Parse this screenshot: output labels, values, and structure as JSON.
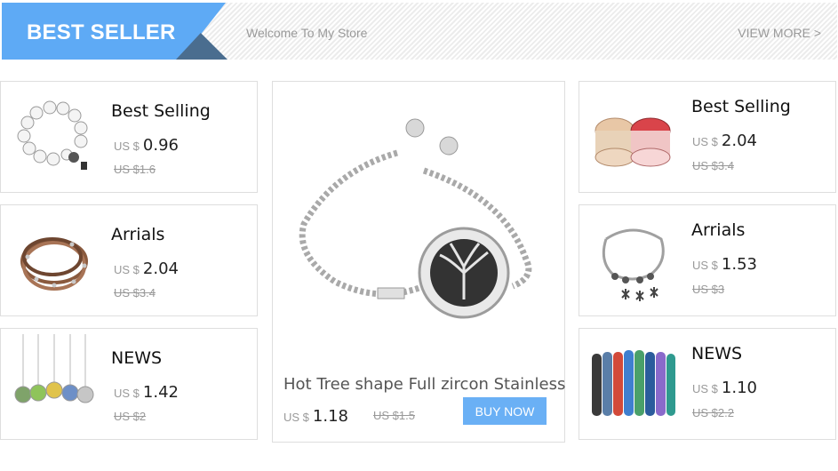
{
  "header": {
    "title": "BEST SELLER",
    "subtitle": "Welcome To My Store",
    "view_more": "VIEW MORE >"
  },
  "left_column": [
    {
      "name": "Best Selling",
      "currency": "US $",
      "price": "0.96",
      "old_price": "US $1.6",
      "icon": "pearl-bracelet-icon"
    },
    {
      "name": "Arrials",
      "currency": "US $",
      "price": "2.04",
      "old_price": "US $3.4",
      "icon": "leather-wrap-bracelet-icon"
    },
    {
      "name": "NEWS",
      "currency": "US $",
      "price": "1.42",
      "old_price": "US $2",
      "icon": "pendant-necklaces-icon"
    }
  ],
  "featured": {
    "title": "Hot Tree shape Full zircon Stainless",
    "currency": "US $",
    "price": "1.18",
    "old_price": "US $1.5",
    "button": "BUY NOW",
    "icon": "tree-of-life-bracelet-icon"
  },
  "right_column": [
    {
      "name": "Best Selling",
      "currency": "US $",
      "price": "2.04",
      "old_price": "US $3.4",
      "icon": "multilayer-bracelets-icon"
    },
    {
      "name": "Arrials",
      "currency": "US $",
      "price": "1.53",
      "old_price": "US $3",
      "icon": "snowflake-charm-bracelet-icon"
    },
    {
      "name": "NEWS",
      "currency": "US $",
      "price": "1.10",
      "old_price": "US $2.2",
      "icon": "bead-bracelets-icon"
    }
  ],
  "colors": {
    "banner_blue": "#5eaaf5",
    "banner_fold": "#4a6d8f",
    "button_blue": "#6ab0f5"
  }
}
